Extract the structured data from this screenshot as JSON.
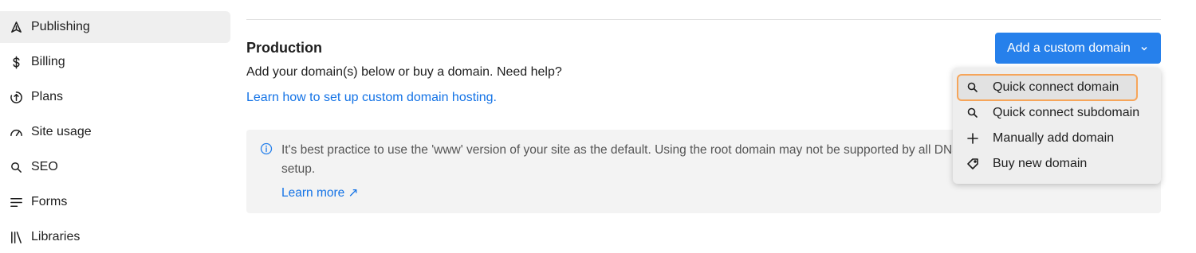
{
  "sidebar": {
    "items": [
      {
        "label": "Publishing",
        "icon": "rocket-icon",
        "active": true
      },
      {
        "label": "Billing",
        "icon": "dollar-icon"
      },
      {
        "label": "Plans",
        "icon": "plans-icon"
      },
      {
        "label": "Site usage",
        "icon": "gauge-icon"
      },
      {
        "label": "SEO",
        "icon": "search-icon"
      },
      {
        "label": "Forms",
        "icon": "forms-icon"
      },
      {
        "label": "Libraries",
        "icon": "libraries-icon"
      }
    ]
  },
  "production": {
    "title": "Production",
    "description": "Add your domain(s) below or buy a domain. Need help?",
    "help_link": "Learn how to set up custom domain hosting.",
    "add_button": "Add a custom domain"
  },
  "info": {
    "text": "It's best practice to use the 'www' version of your site as the default. Using the root domain may not be supported by all DNS providers and requires manual setup.",
    "link": "Learn more ↗"
  },
  "dropdown": {
    "items": [
      {
        "label": "Quick connect domain",
        "icon": "search-icon",
        "highlighted": true
      },
      {
        "label": "Quick connect subdomain",
        "icon": "search-icon"
      },
      {
        "label": "Manually add domain",
        "icon": "plus-icon"
      },
      {
        "label": "Buy new domain",
        "icon": "tag-icon"
      }
    ]
  },
  "colors": {
    "accent": "#2680eb",
    "link": "#1473e6",
    "highlight_border": "#f6a55a"
  }
}
